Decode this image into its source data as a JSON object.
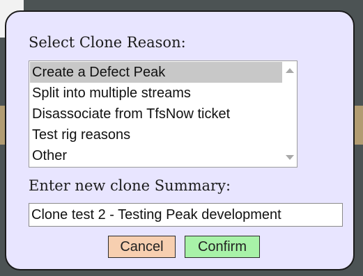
{
  "dialog": {
    "reason_label": "Select Clone Reason:",
    "reason_options": [
      "Create a Defect Peak",
      "Split into multiple streams",
      "Disassociate from TfsNow ticket",
      "Test rig reasons",
      "Other"
    ],
    "selected_option": "Create a Defect Peak",
    "summary_label": "Enter new clone Summary:",
    "summary_value": "Clone test 2 - Testing Peak development",
    "cancel_label": "Cancel",
    "confirm_label": "Confirm"
  },
  "colors": {
    "dialog_background": "#e8e5ff",
    "cancel_button": "#f7cfb0",
    "confirm_button": "#a8f2a8",
    "selected_option": "#c8c8c8"
  },
  "icons": {
    "scroll_up": "scroll-up-arrow-icon",
    "scroll_down": "scroll-down-arrow-icon"
  }
}
